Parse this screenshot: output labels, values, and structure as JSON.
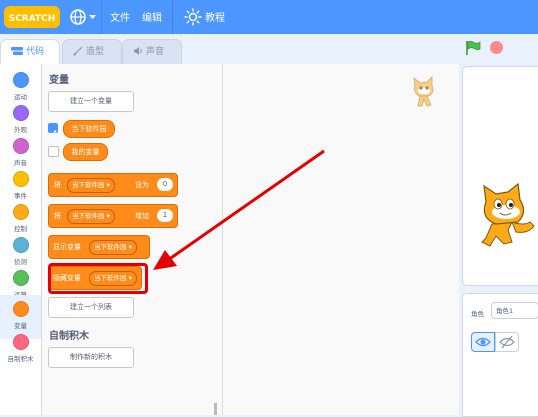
{
  "menubar": {
    "logo": "SCRATCH",
    "file": "文件",
    "edit": "编辑",
    "tutorials": "教程"
  },
  "tabs": {
    "code": "代码",
    "costumes": "造型",
    "sounds": "声音"
  },
  "categories": [
    {
      "label": "运动",
      "color": "#4c97ff"
    },
    {
      "label": "外观",
      "color": "#9966ff"
    },
    {
      "label": "声音",
      "color": "#cf63cf"
    },
    {
      "label": "事件",
      "color": "#ffbf00"
    },
    {
      "label": "控制",
      "color": "#ffab19"
    },
    {
      "label": "侦测",
      "color": "#5cb1d6"
    },
    {
      "label": "运算",
      "color": "#59c059"
    },
    {
      "label": "变量",
      "color": "#ff8c1a"
    },
    {
      "label": "自制积木",
      "color": "#ff6680"
    }
  ],
  "palette": {
    "variables_title": "变量",
    "make_variable": "建立一个变量",
    "var1": "当下软件园",
    "var2": "我的变量",
    "set_block": {
      "prefix": "将",
      "var": "当下软件园",
      "suffix": "设为",
      "value": "0"
    },
    "change_block": {
      "prefix": "将",
      "var": "当下软件园",
      "suffix": "增加",
      "value": "1"
    },
    "show_block": {
      "prefix": "显示变量",
      "var": "当下软件园"
    },
    "hide_block": {
      "prefix": "隐藏变量",
      "var": "当下软件园"
    },
    "make_list": "建立一个列表",
    "myblocks_title": "自制积木",
    "make_block": "制作新的积木"
  },
  "sprite_info": {
    "label": "角色",
    "name": "角色1"
  },
  "colors": {
    "accent": "#4c97ff",
    "variables": "#ff8c1a",
    "highlight": "#e40000"
  }
}
